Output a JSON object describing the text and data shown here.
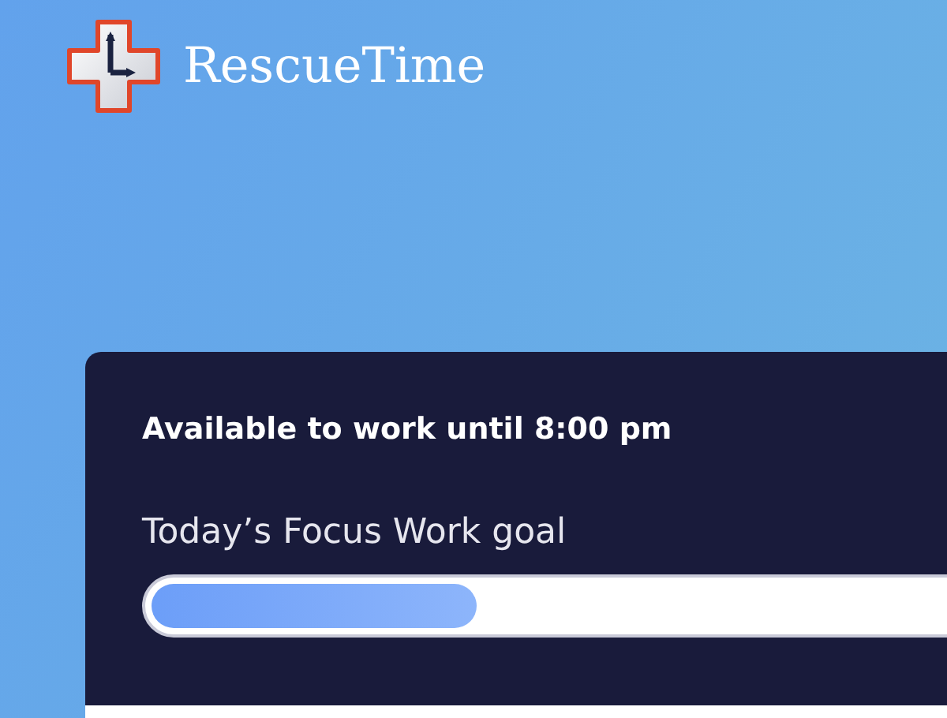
{
  "brand": {
    "name": "RescueTime"
  },
  "card": {
    "heading": "Available to work until 8:00 pm",
    "goal_label": "Today’s Focus Work goal",
    "goal_progress": {
      "level": 0.35
    }
  }
}
